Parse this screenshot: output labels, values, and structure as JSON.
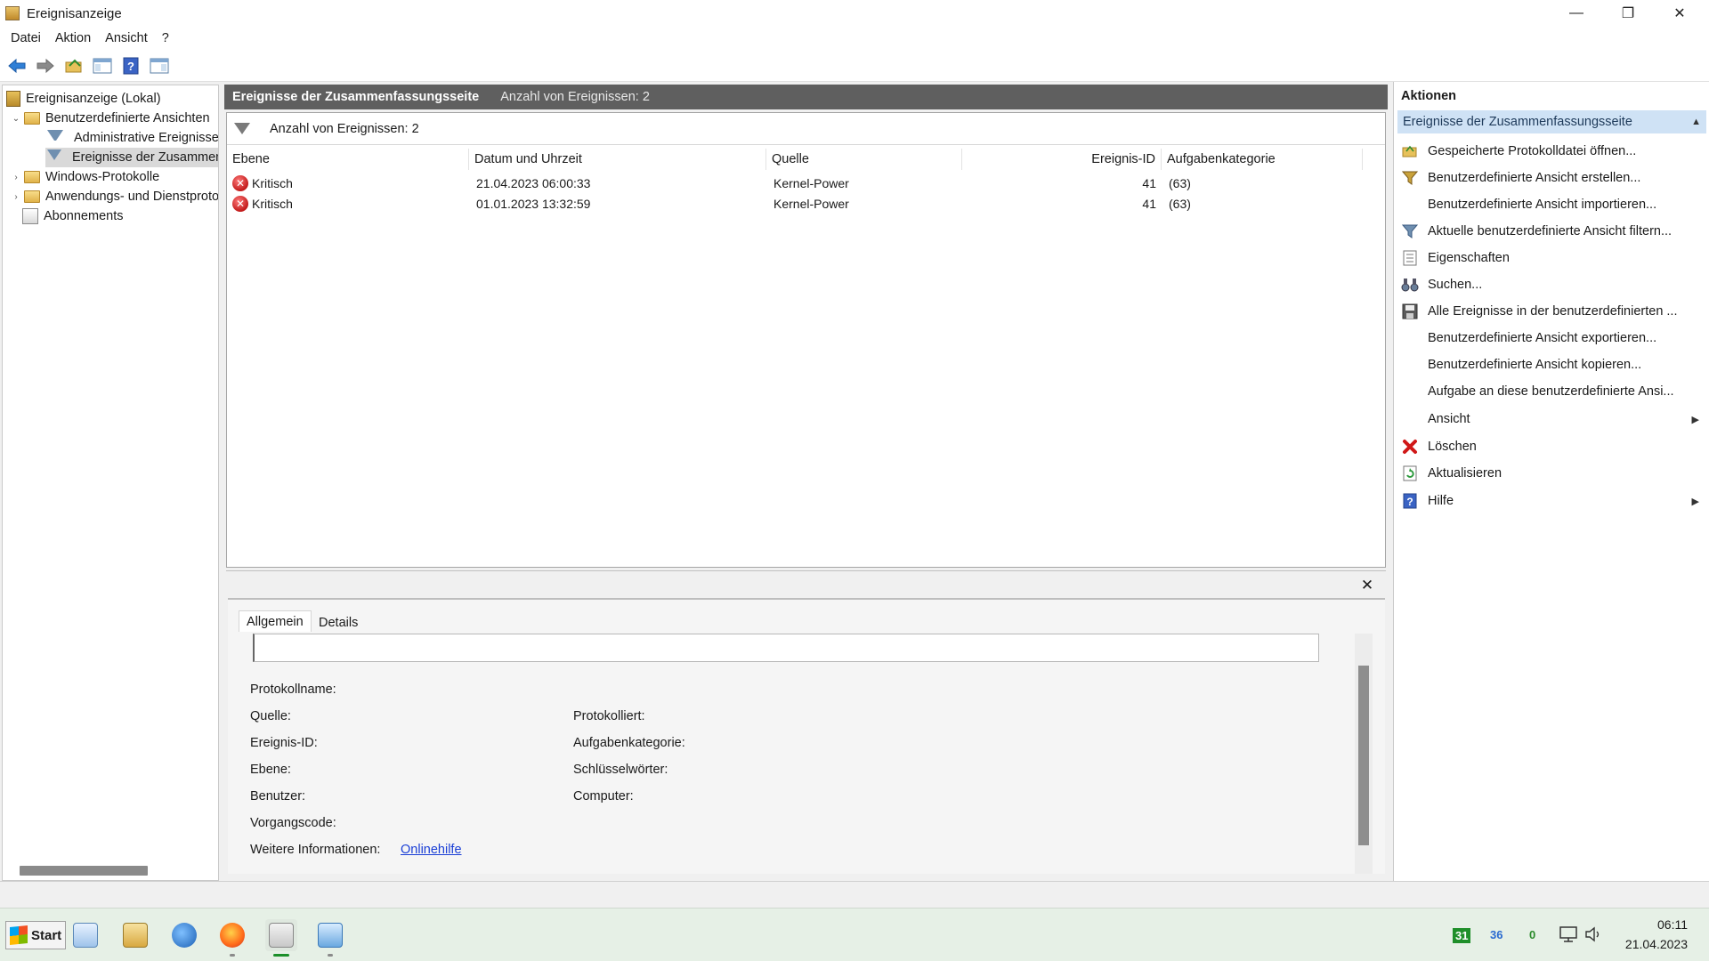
{
  "window": {
    "title": "Ereignisanzeige",
    "controls": {
      "minimize": "—",
      "restore": "❐",
      "close": "✕"
    }
  },
  "menu": [
    "Datei",
    "Aktion",
    "Ansicht",
    "?"
  ],
  "toolbar": {
    "icons": [
      "back-arrow-icon",
      "forward-arrow-icon",
      "open-folder-icon",
      "show-hide-tree-icon",
      "help-icon",
      "show-hide-action-pane-icon"
    ]
  },
  "tree": {
    "items": [
      {
        "label": "Ereignisanzeige (Lokal)",
        "icon": "event-viewer-icon",
        "level": 0,
        "expander": ""
      },
      {
        "label": "Benutzerdefinierte Ansichten",
        "icon": "folder-icon",
        "level": 1,
        "expander": "⌄"
      },
      {
        "label": "Administrative Ereignisse",
        "icon": "filter-icon",
        "level": 2,
        "expander": ""
      },
      {
        "label": "Ereignisse der Zusammenfassungsseite",
        "icon": "filter-icon",
        "level": 2,
        "expander": "",
        "selected": true
      },
      {
        "label": "Windows-Protokolle",
        "icon": "folder-icon",
        "level": 1,
        "expander": "›"
      },
      {
        "label": "Anwendungs- und Dienstprotokolle",
        "icon": "folder-icon",
        "level": 1,
        "expander": "›"
      },
      {
        "label": "Abonnements",
        "icon": "subscription-icon",
        "level": 1,
        "expander": ""
      }
    ]
  },
  "center": {
    "header_title": "Ereignisse der Zusammenfassungsseite",
    "header_count": "Anzahl von Ereignissen: 2",
    "filter_count": "Anzahl von Ereignissen: 2",
    "columns": [
      "Ebene",
      "Datum und Uhrzeit",
      "Quelle",
      "Ereignis-ID",
      "Aufgabenkategorie"
    ],
    "rows": [
      {
        "level": "Kritisch",
        "datetime": "21.04.2023 06:00:33",
        "source": "Kernel-Power",
        "id": "41",
        "category": "(63)"
      },
      {
        "level": "Kritisch",
        "datetime": "01.01.2023 13:32:59",
        "source": "Kernel-Power",
        "id": "41",
        "category": "(63)"
      }
    ]
  },
  "details": {
    "close": "✕",
    "tabs": [
      "Allgemein",
      "Details"
    ],
    "labels_left": [
      "Protokollname:",
      "Quelle:",
      "Ereignis-ID:",
      "Ebene:",
      "Benutzer:",
      "Vorgangscode:",
      "Weitere Informationen:"
    ],
    "labels_right": [
      "Protokolliert:",
      "Aufgabenkategorie:",
      "Schlüsselwörter:",
      "Computer:"
    ],
    "link": "Onlinehilfe"
  },
  "actions": {
    "title": "Aktionen",
    "section": "Ereignisse der Zusammenfassungsseite",
    "items": [
      {
        "label": "Gespeicherte Protokolldatei öffnen...",
        "icon": "open-folder-icon"
      },
      {
        "label": "Benutzerdefinierte Ansicht erstellen...",
        "icon": "filter-star-icon"
      },
      {
        "label": "Benutzerdefinierte Ansicht importieren...",
        "icon": ""
      },
      {
        "label": "Aktuelle benutzerdefinierte Ansicht filtern...",
        "icon": "filter-icon"
      },
      {
        "label": "Eigenschaften",
        "icon": "properties-icon"
      },
      {
        "label": "Suchen...",
        "icon": "binoculars-icon"
      },
      {
        "label": "Alle Ereignisse in der benutzerdefinierten ...",
        "icon": "save-icon"
      },
      {
        "label": "Benutzerdefinierte Ansicht exportieren...",
        "icon": ""
      },
      {
        "label": "Benutzerdefinierte Ansicht kopieren...",
        "icon": ""
      },
      {
        "label": "Aufgabe an diese benutzerdefinierte Ansi...",
        "icon": ""
      },
      {
        "label": "Ansicht",
        "icon": "",
        "submenu": true
      },
      {
        "label": "Löschen",
        "icon": "delete-icon"
      },
      {
        "label": "Aktualisieren",
        "icon": "refresh-icon"
      },
      {
        "label": "Hilfe",
        "icon": "help-icon",
        "submenu": true
      }
    ]
  },
  "taskbar": {
    "start_label": "Start",
    "apps": [
      "notes-icon",
      "file-explorer-icon",
      "thunderbird-icon",
      "firefox-icon",
      "event-viewer-icon",
      "control-panel-icon"
    ],
    "tray_numbers": [
      "31",
      "36",
      "0"
    ],
    "time": "06:11",
    "date": "21.04.2023"
  }
}
